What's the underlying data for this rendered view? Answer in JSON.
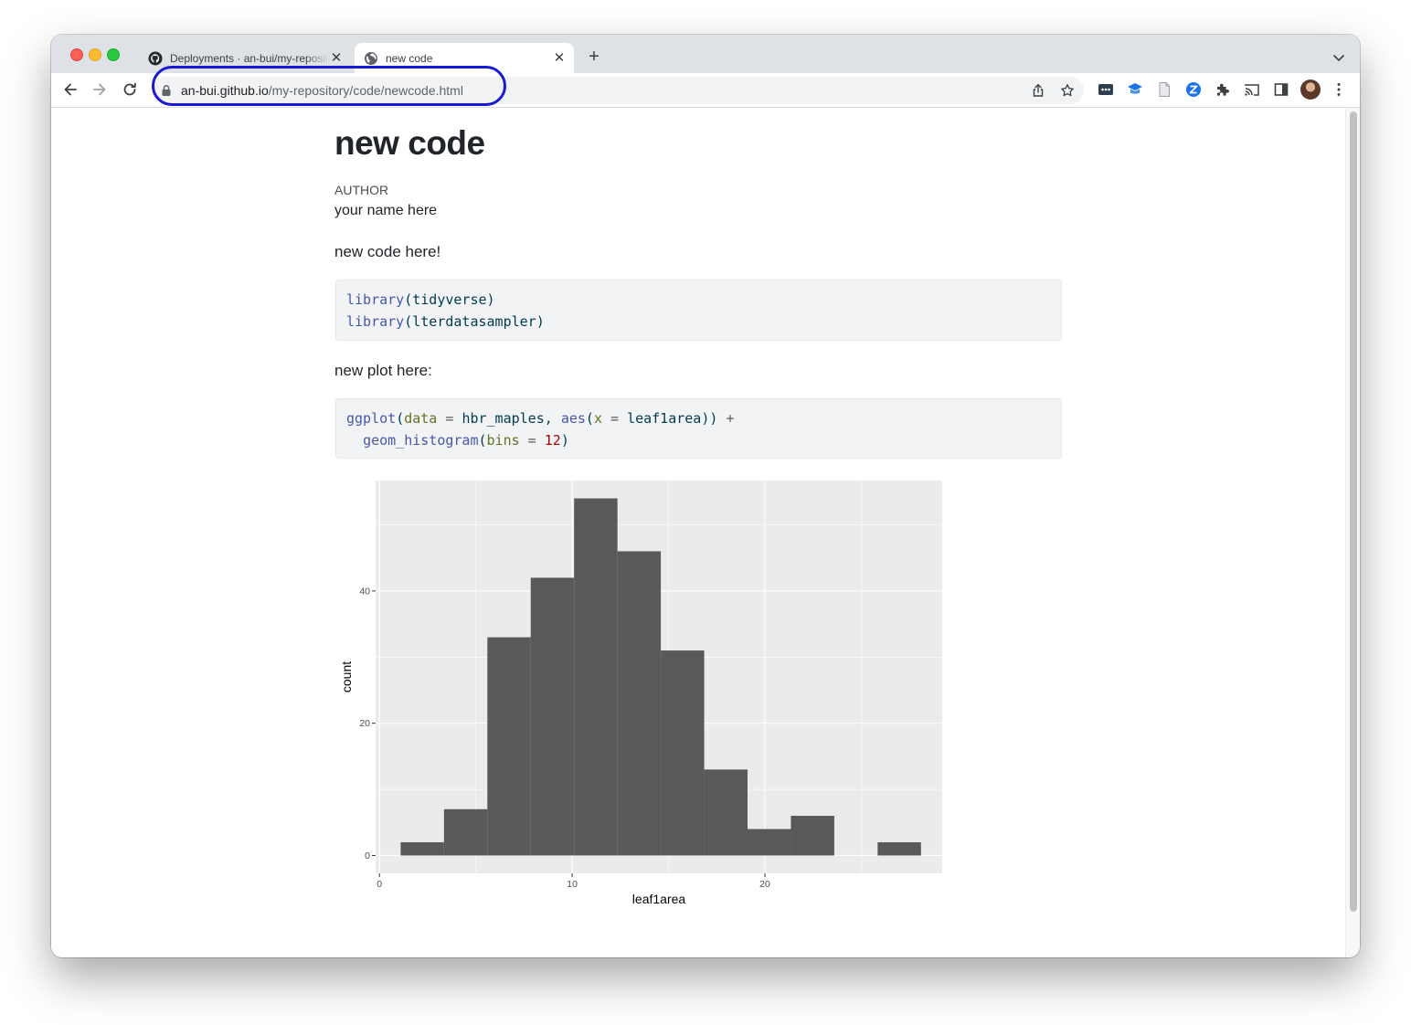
{
  "browser": {
    "tabs": [
      {
        "title": "Deployments · an-bui/my-repository",
        "favicon": "github-icon",
        "active": false
      },
      {
        "title": "new code",
        "favicon": "globe-icon",
        "active": true
      }
    ],
    "url_host": "an-bui.github.io",
    "url_path": "/my-repository/code/newcode.html"
  },
  "page": {
    "title": "new code",
    "author_label": "AUTHOR",
    "author_name": "your name here",
    "para1": "new code here!",
    "para2": "new plot here:"
  },
  "code_blocks": [
    [
      [
        {
          "t": "library",
          "c": "fn"
        },
        {
          "t": "(tidyverse)",
          "c": ""
        }
      ],
      [
        {
          "t": "library",
          "c": "fn"
        },
        {
          "t": "(lterdatasampler)",
          "c": ""
        }
      ]
    ],
    [
      [
        {
          "t": "ggplot",
          "c": "fn"
        },
        {
          "t": "(",
          "c": ""
        },
        {
          "t": "data",
          "c": "arg"
        },
        {
          "t": " = ",
          "c": "op"
        },
        {
          "t": "hbr_maples, ",
          "c": ""
        },
        {
          "t": "aes",
          "c": "fn"
        },
        {
          "t": "(",
          "c": ""
        },
        {
          "t": "x",
          "c": "arg"
        },
        {
          "t": " = ",
          "c": "op"
        },
        {
          "t": "leaf1area)) ",
          "c": ""
        },
        {
          "t": "+",
          "c": "op"
        }
      ],
      [
        {
          "t": "  ",
          "c": ""
        },
        {
          "t": "geom_histogram",
          "c": "fn"
        },
        {
          "t": "(",
          "c": ""
        },
        {
          "t": "bins",
          "c": "arg"
        },
        {
          "t": " = ",
          "c": "op"
        },
        {
          "t": "12",
          "c": "num"
        },
        {
          "t": ")",
          "c": ""
        }
      ]
    ]
  ],
  "chart_data": {
    "type": "bar",
    "subtype": "histogram",
    "xlabel": "leaf1area",
    "ylabel": "count",
    "xlim": [
      -0.2,
      29.2
    ],
    "ylim": [
      -2.7,
      56.7
    ],
    "x_ticks": [
      0,
      10,
      20
    ],
    "y_ticks": [
      0,
      20,
      40
    ],
    "grid": true,
    "bar_color": "#595959",
    "panel_color": "#ebebeb",
    "bins": [
      {
        "x0": 1.1,
        "x1": 3.35,
        "count": 2
      },
      {
        "x0": 3.35,
        "x1": 5.6,
        "count": 7
      },
      {
        "x0": 5.6,
        "x1": 7.85,
        "count": 33
      },
      {
        "x0": 7.85,
        "x1": 10.1,
        "count": 42
      },
      {
        "x0": 10.1,
        "x1": 12.35,
        "count": 54
      },
      {
        "x0": 12.35,
        "x1": 14.6,
        "count": 46
      },
      {
        "x0": 14.6,
        "x1": 16.85,
        "count": 31
      },
      {
        "x0": 16.85,
        "x1": 19.1,
        "count": 13
      },
      {
        "x0": 19.1,
        "x1": 21.35,
        "count": 4
      },
      {
        "x0": 21.35,
        "x1": 23.6,
        "count": 6
      },
      {
        "x0": 23.6,
        "x1": 25.85,
        "count": 0
      },
      {
        "x0": 25.85,
        "x1": 28.1,
        "count": 2
      }
    ]
  }
}
